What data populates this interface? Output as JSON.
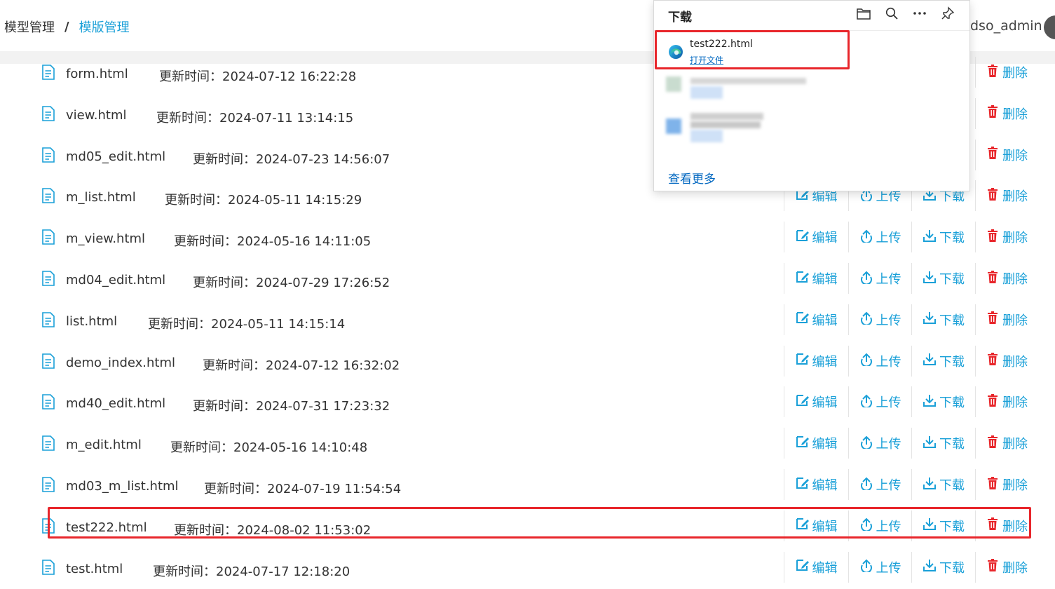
{
  "breadcrumb": {
    "root": "模型管理",
    "separator": "/",
    "current": "模版管理"
  },
  "user": {
    "name": "dso_admin"
  },
  "files": [
    {
      "name": "form.html",
      "time_label": "更新时间：",
      "time": "2024-07-12 16:22:28"
    },
    {
      "name": "view.html",
      "time_label": "更新时间：",
      "time": "2024-07-11 13:14:15"
    },
    {
      "name": "md05_edit.html",
      "time_label": "更新时间：",
      "time": "2024-07-23 14:56:07"
    },
    {
      "name": "m_list.html",
      "time_label": "更新时间：",
      "time": "2024-05-11 14:15:29"
    },
    {
      "name": "m_view.html",
      "time_label": "更新时间：",
      "time": "2024-05-16 14:11:05"
    },
    {
      "name": "md04_edit.html",
      "time_label": "更新时间：",
      "time": "2024-07-29 17:26:52"
    },
    {
      "name": "list.html",
      "time_label": "更新时间：",
      "time": "2024-05-11 14:15:14"
    },
    {
      "name": "demo_index.html",
      "time_label": "更新时间：",
      "time": "2024-07-12 16:32:02"
    },
    {
      "name": "md40_edit.html",
      "time_label": "更新时间：",
      "time": "2024-07-31 17:23:32"
    },
    {
      "name": "m_edit.html",
      "time_label": "更新时间：",
      "time": "2024-05-16 14:10:48"
    },
    {
      "name": "md03_m_list.html",
      "time_label": "更新时间：",
      "time": "2024-07-19 11:54:54"
    },
    {
      "name": "test222.html",
      "time_label": "更新时间：",
      "time": "2024-08-02 11:53:02"
    },
    {
      "name": "test.html",
      "time_label": "更新时间：",
      "time": "2024-07-17 12:18:20"
    }
  ],
  "actions": {
    "edit": "编辑",
    "upload": "上传",
    "download": "下载",
    "delete": "删除"
  },
  "download_panel": {
    "title": "下载",
    "tools": [
      "folder-icon",
      "search-icon",
      "more-icon",
      "pin-icon"
    ],
    "item": {
      "filename": "test222.html",
      "open_label": "打开文件"
    },
    "see_more": "查看更多"
  },
  "colors": {
    "accent": "#1aa0d8",
    "delete": "#e8262b",
    "highlight": "#e8262b",
    "link": "#0067c0"
  }
}
